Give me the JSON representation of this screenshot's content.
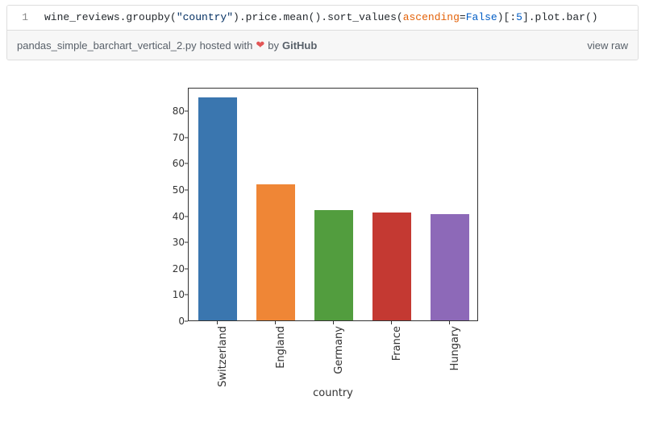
{
  "gist": {
    "line_number": "1",
    "code": {
      "p1": "wine_reviews.groupby(",
      "str": "\"country\"",
      "p2": ").price.mean().sort_values(",
      "kwarg": "ascending",
      "eq": "=",
      "const": "False",
      "p3": ")[:",
      "num": "5",
      "p4": "].plot.bar()"
    },
    "filename": "pandas_simple_barchart_vertical_2.py",
    "hosted_with": " hosted with ",
    "heart": "❤",
    "by": "  by ",
    "github": "GitHub",
    "view_raw": "view raw"
  },
  "chart_data": {
    "type": "bar",
    "categories": [
      "Switzerland",
      "England",
      "Germany",
      "France",
      "Hungary"
    ],
    "values": [
      85,
      52,
      42,
      41,
      40.5
    ],
    "colors": [
      "#3a76af",
      "#ef8636",
      "#529d3e",
      "#c43932",
      "#8d69b8"
    ],
    "xlabel": "country",
    "ylabel": "",
    "title": "",
    "yticks": [
      0,
      10,
      20,
      30,
      40,
      50,
      60,
      70,
      80
    ],
    "ylim": [
      0,
      89
    ]
  }
}
